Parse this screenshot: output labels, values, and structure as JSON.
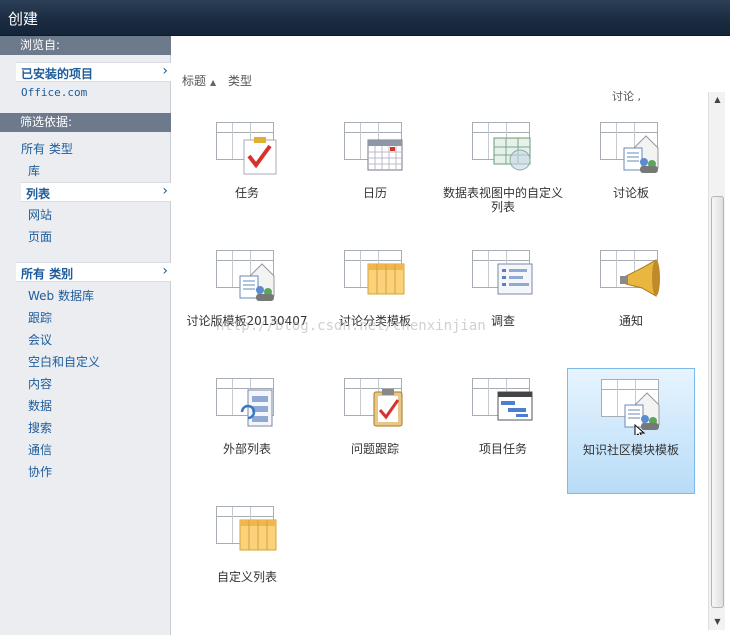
{
  "window": {
    "title": "创建"
  },
  "left": {
    "browse_header": "浏览自:",
    "browse_selected": "已安装的项目",
    "browse_other": "Office.com",
    "filter_header": "筛选依据:",
    "type_group_label": "所有 类型",
    "type_items": [
      "库",
      "列表",
      "网站",
      "页面"
    ],
    "type_selected_index": 1,
    "category_group_label": "所有 类别",
    "category_items": [
      "Web 数据库",
      "跟踪",
      "会议",
      "空白和自定义",
      "内容",
      "数据",
      "搜索",
      "通信",
      "协作"
    ]
  },
  "main": {
    "sort": {
      "title": "标题",
      "type": "类型"
    },
    "cutoff_label": "讨论 ,",
    "tiles": [
      {
        "label": "任务",
        "icon": "task-check-icon"
      },
      {
        "label": "日历",
        "icon": "calendar-icon"
      },
      {
        "label": "数据表视图中的自定义列表",
        "icon": "datasheet-custom-list-icon"
      },
      {
        "label": "讨论板",
        "icon": "discussion-board-icon"
      },
      {
        "label": "讨论版模板20130407",
        "icon": "discussion-template-icon"
      },
      {
        "label": "讨论分类模板",
        "icon": "category-grid-icon"
      },
      {
        "label": "调查",
        "icon": "survey-icon"
      },
      {
        "label": "通知",
        "icon": "announcement-megaphone-icon"
      },
      {
        "label": "外部列表",
        "icon": "external-list-icon"
      },
      {
        "label": "问题跟踪",
        "icon": "issue-clipboard-icon"
      },
      {
        "label": "项目任务",
        "icon": "project-gantt-icon"
      },
      {
        "label": "知识社区模块模板",
        "icon": "community-template-icon"
      },
      {
        "label": "自定义列表",
        "icon": "custom-list-icon"
      }
    ],
    "selected_tile_index": 11
  },
  "watermark": "http://blog.csdn.net/chenxinjian",
  "colors": {
    "link": "#1d5c9a",
    "titlebar": "#1a2b40",
    "section": "#6c7a8c",
    "selection": "#b8dcf7"
  }
}
